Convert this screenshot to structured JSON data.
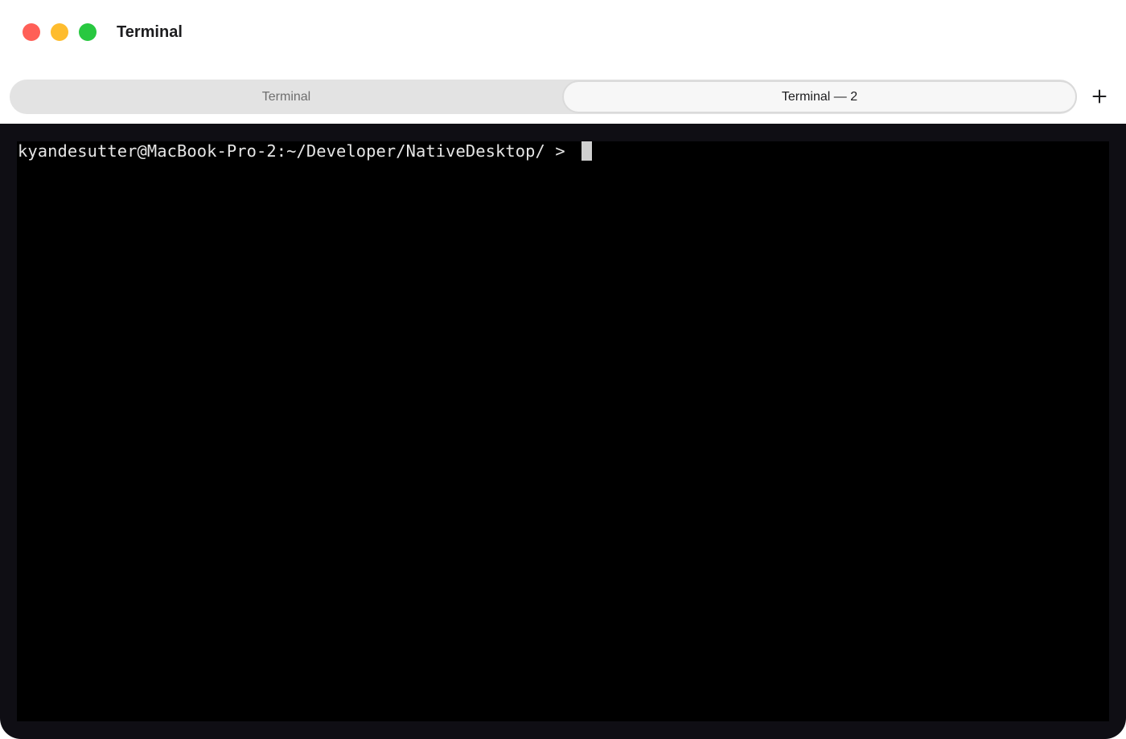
{
  "window": {
    "title": "Terminal"
  },
  "traffic_lights": {
    "close_color": "#ff5f57",
    "minimize_color": "#febc2e",
    "zoom_color": "#28c840"
  },
  "tabs": [
    {
      "label": "Terminal",
      "active": false
    },
    {
      "label": "Terminal — 2",
      "active": true
    }
  ],
  "new_tab": {
    "icon": "plus-icon"
  },
  "terminal": {
    "prompt": "kyandesutter@MacBook-Pro-2:~/Developer/NativeDesktop/ > ",
    "foreground": "#e6e6e6",
    "background": "#000000"
  }
}
